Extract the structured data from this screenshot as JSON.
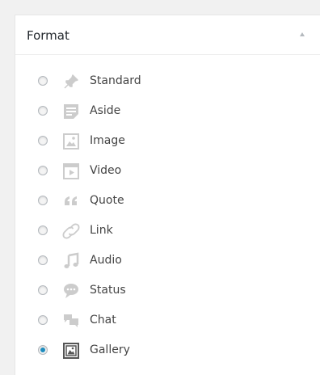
{
  "panel": {
    "title": "Format",
    "toggle_icon": "triangle-up-icon"
  },
  "formats": [
    {
      "label": "Standard",
      "icon": "pin-icon",
      "checked": false
    },
    {
      "label": "Aside",
      "icon": "aside-icon",
      "checked": false
    },
    {
      "label": "Image",
      "icon": "image-icon",
      "checked": false
    },
    {
      "label": "Video",
      "icon": "video-icon",
      "checked": false
    },
    {
      "label": "Quote",
      "icon": "quote-icon",
      "checked": false
    },
    {
      "label": "Link",
      "icon": "link-icon",
      "checked": false
    },
    {
      "label": "Audio",
      "icon": "audio-icon",
      "checked": false
    },
    {
      "label": "Status",
      "icon": "status-icon",
      "checked": false
    },
    {
      "label": "Chat",
      "icon": "chat-icon",
      "checked": false
    },
    {
      "label": "Gallery",
      "icon": "gallery-icon",
      "checked": true
    }
  ],
  "colors": {
    "icon": "#cccccc",
    "icon_active": "#555555",
    "radio_checked": "#1e8cbe",
    "text": "#444444"
  }
}
